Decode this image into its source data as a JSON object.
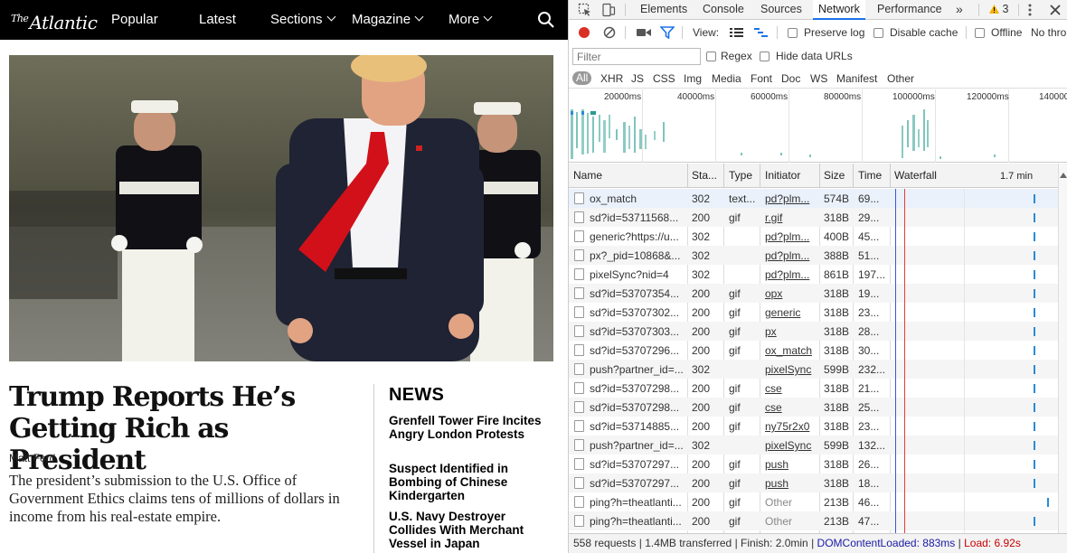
{
  "site": {
    "logo": {
      "the": "The",
      "name": "Atlantic"
    },
    "nav": {
      "popular": "Popular",
      "latest": "Latest",
      "sections": "Sections",
      "magazine": "Magazine",
      "more": "More"
    },
    "article": {
      "headline": "Trump Reports He’s Getting Rich as President",
      "author": "Matt Ford",
      "dek": "The president’s submission to the U.S. Office of Government Ethics claims tens of millions of dollars in income from his real-estate empire."
    },
    "news": {
      "title": "NEWS",
      "items": [
        "Grenfell Tower Fire Incites Angry London Protests",
        "Suspect Identified in Bombing of Chinese Kindergarten",
        "U.S. Navy Destroyer Collides With Merchant Vessel in Japan"
      ]
    }
  },
  "devtools": {
    "tabs": [
      "Elements",
      "Console",
      "Sources",
      "Network",
      "Performance"
    ],
    "active_tab": "Network",
    "more_tabs": "»",
    "warnings": "3",
    "toolbar": {
      "view": "View:",
      "preserve_log": "Preserve log",
      "disable_cache": "Disable cache",
      "offline": "Offline",
      "throttle": "No thro"
    },
    "filter": {
      "placeholder": "Filter",
      "regex": "Regex",
      "hide_data_urls": "Hide data URLs",
      "types": [
        "All",
        "XHR",
        "JS",
        "CSS",
        "Img",
        "Media",
        "Font",
        "Doc",
        "WS",
        "Manifest",
        "Other"
      ]
    },
    "overview_ticks": [
      "20000ms",
      "40000ms",
      "60000ms",
      "80000ms",
      "100000ms",
      "120000ms",
      "140000"
    ],
    "columns": {
      "name": "Name",
      "status": "Sta...",
      "type": "Type",
      "initiator": "Initiator",
      "size": "Size",
      "time": "Time",
      "waterfall": "Waterfall",
      "waterfall_scale": "1.7 min"
    },
    "rows": [
      {
        "name": "ox_match",
        "status": "302",
        "type": "text...",
        "initiator": "pd?plm...",
        "size": "574B",
        "time": "69..."
      },
      {
        "name": "sd?id=53711568...",
        "status": "200",
        "type": "gif",
        "initiator": "r.gif",
        "size": "318B",
        "time": "29..."
      },
      {
        "name": "generic?https://u...",
        "status": "302",
        "type": "",
        "initiator": "pd?plm...",
        "size": "400B",
        "time": "45..."
      },
      {
        "name": "px?_pid=10868&...",
        "status": "302",
        "type": "",
        "initiator": "pd?plm...",
        "size": "388B",
        "time": "51..."
      },
      {
        "name": "pixelSync?nid=4",
        "status": "302",
        "type": "",
        "initiator": "pd?plm...",
        "size": "861B",
        "time": "197..."
      },
      {
        "name": "sd?id=53707354...",
        "status": "200",
        "type": "gif",
        "initiator": "opx",
        "size": "318B",
        "time": "19..."
      },
      {
        "name": "sd?id=53707302...",
        "status": "200",
        "type": "gif",
        "initiator": "generic",
        "size": "318B",
        "time": "23..."
      },
      {
        "name": "sd?id=53707303...",
        "status": "200",
        "type": "gif",
        "initiator": "px",
        "size": "318B",
        "time": "28..."
      },
      {
        "name": "sd?id=53707296...",
        "status": "200",
        "type": "gif",
        "initiator": "ox_match",
        "size": "318B",
        "time": "30..."
      },
      {
        "name": "push?partner_id=...",
        "status": "302",
        "type": "",
        "initiator": "pixelSync",
        "size": "599B",
        "time": "232..."
      },
      {
        "name": "sd?id=53707298...",
        "status": "200",
        "type": "gif",
        "initiator": "cse",
        "size": "318B",
        "time": "21..."
      },
      {
        "name": "sd?id=53707298...",
        "status": "200",
        "type": "gif",
        "initiator": "cse",
        "size": "318B",
        "time": "25..."
      },
      {
        "name": "sd?id=53714885...",
        "status": "200",
        "type": "gif",
        "initiator": "ny75r2x0",
        "size": "318B",
        "time": "23..."
      },
      {
        "name": "push?partner_id=...",
        "status": "302",
        "type": "",
        "initiator": "pixelSync",
        "size": "599B",
        "time": "132..."
      },
      {
        "name": "sd?id=53707297...",
        "status": "200",
        "type": "gif",
        "initiator": "push",
        "size": "318B",
        "time": "26..."
      },
      {
        "name": "sd?id=53707297...",
        "status": "200",
        "type": "gif",
        "initiator": "push",
        "size": "318B",
        "time": "18..."
      },
      {
        "name": "ping?h=theatlanti...",
        "status": "200",
        "type": "gif",
        "initiator": "Other",
        "size": "213B",
        "time": "46..."
      },
      {
        "name": "ping?h=theatlanti...",
        "status": "200",
        "type": "gif",
        "initiator": "Other",
        "size": "213B",
        "time": "47..."
      }
    ],
    "status": {
      "requests": "558 requests",
      "transferred": "1.4MB transferred",
      "finish": "Finish: 2.0min",
      "dcl": "DOMContentLoaded: 883ms",
      "load": "Load: 6.92s"
    }
  }
}
